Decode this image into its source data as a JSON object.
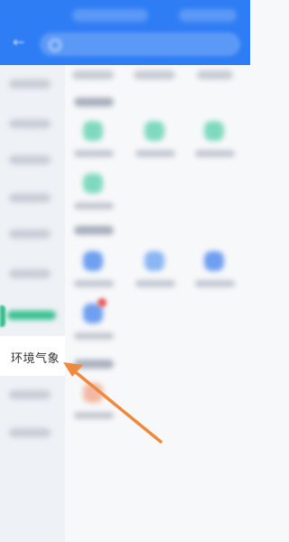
{
  "sidebar": {
    "active_label": "环境气象"
  },
  "colors": {
    "header": "#2f7df4",
    "accent_green": "#36c08f",
    "arrow": "#f0893c"
  }
}
